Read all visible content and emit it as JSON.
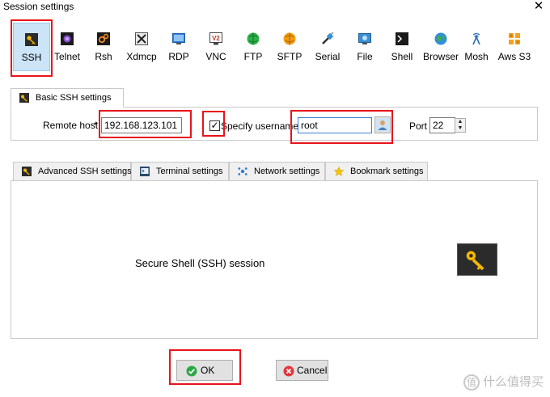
{
  "window": {
    "title": "Session settings",
    "close_glyph": "✕"
  },
  "session_types": [
    {
      "label": "SSH",
      "icon": "ssh-key-icon",
      "selected": true
    },
    {
      "label": "Telnet",
      "icon": "telnet-icon"
    },
    {
      "label": "Rsh",
      "icon": "rsh-icon"
    },
    {
      "label": "Xdmcp",
      "icon": "xdmcp-icon"
    },
    {
      "label": "RDP",
      "icon": "rdp-icon"
    },
    {
      "label": "VNC",
      "icon": "vnc-icon"
    },
    {
      "label": "FTP",
      "icon": "ftp-icon"
    },
    {
      "label": "SFTP",
      "icon": "sftp-icon"
    },
    {
      "label": "Serial",
      "icon": "serial-icon"
    },
    {
      "label": "File",
      "icon": "file-icon"
    },
    {
      "label": "Shell",
      "icon": "shell-icon"
    },
    {
      "label": "Browser",
      "icon": "browser-icon"
    },
    {
      "label": "Mosh",
      "icon": "mosh-icon"
    },
    {
      "label": "Aws S3",
      "icon": "aws-s3-icon"
    }
  ],
  "basic": {
    "tab_label": "Basic SSH settings",
    "remote_host_label": "Remote host",
    "required_mark": "*",
    "remote_host_value": "192.168.123.101",
    "specify_username_label": "Specify username",
    "specify_username_checked": true,
    "checkmark": "✓",
    "username_value": "root",
    "port_label": "Port",
    "port_value": "22"
  },
  "advanced_tabs": [
    {
      "label": "Advanced SSH settings",
      "icon": "ssh-key-icon"
    },
    {
      "label": "Terminal settings",
      "icon": "terminal-icon"
    },
    {
      "label": "Network settings",
      "icon": "network-icon"
    },
    {
      "label": "Bookmark settings",
      "icon": "star-icon"
    }
  ],
  "description": "Secure Shell (SSH) session",
  "buttons": {
    "ok": "OK",
    "cancel": "Cancel"
  },
  "watermark": {
    "badge": "值",
    "text": "什么值得买"
  },
  "colors": {
    "selection_bg": "#cce4f7",
    "highlight_red": "#e8141a",
    "key_gold": "#f5b800",
    "ok_green": "#2aa845",
    "cancel_red": "#e2373f"
  }
}
